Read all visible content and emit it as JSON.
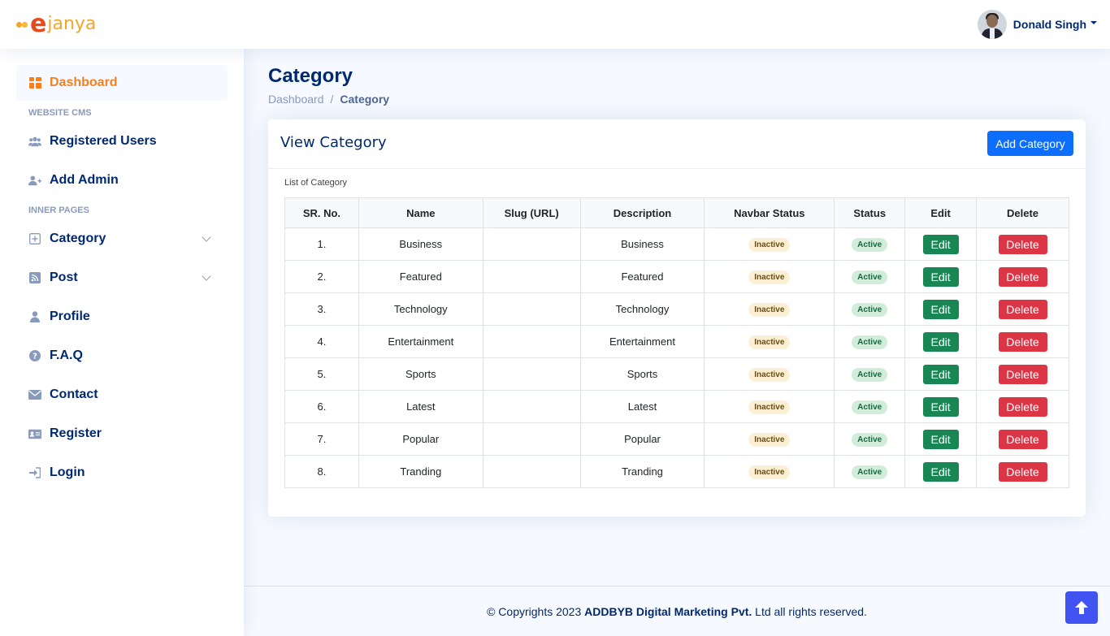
{
  "header": {
    "logo_e": "e",
    "logo_rest": "janya",
    "user_name": "Donald Singh"
  },
  "sidebar": {
    "items": [
      {
        "label": "Dashboard",
        "icon": "grid-icon"
      },
      {
        "label": "Registered Users",
        "icon": "people-icon"
      },
      {
        "label": "Add Admin",
        "icon": "person-plus-icon"
      },
      {
        "label": "Category",
        "icon": "plus-square-icon"
      },
      {
        "label": "Post",
        "icon": "rss-icon"
      },
      {
        "label": "Profile",
        "icon": "person-icon"
      },
      {
        "label": "F.A.Q",
        "icon": "question-circle-icon"
      },
      {
        "label": "Contact",
        "icon": "envelope-icon"
      },
      {
        "label": "Register",
        "icon": "card-icon"
      },
      {
        "label": "Login",
        "icon": "login-icon"
      }
    ],
    "headings": [
      "WEBSITE CMS",
      "INNER PAGES"
    ]
  },
  "page": {
    "title": "Category",
    "breadcrumb": [
      "Dashboard",
      "/",
      "Category"
    ]
  },
  "card": {
    "title": "View Category",
    "add_button": "Add Category",
    "caption": "List of Category",
    "columns": [
      "SR. No.",
      "Name",
      "Slug (URL)",
      "Description",
      "Navbar Status",
      "Status",
      "Edit",
      "Delete"
    ],
    "rows": [
      {
        "sr": "1.",
        "name": "Business",
        "slug": "",
        "desc": "Business",
        "navbar": "Inactive",
        "status": "Active",
        "edit": "Edit",
        "delete": "Delete"
      },
      {
        "sr": "2.",
        "name": "Featured",
        "slug": "",
        "desc": "Featured",
        "navbar": "Inactive",
        "status": "Active",
        "edit": "Edit",
        "delete": "Delete"
      },
      {
        "sr": "3.",
        "name": "Technology",
        "slug": "",
        "desc": "Technology",
        "navbar": "Inactive",
        "status": "Active",
        "edit": "Edit",
        "delete": "Delete"
      },
      {
        "sr": "4.",
        "name": "Entertainment",
        "slug": "",
        "desc": "Entertainment",
        "navbar": "Inactive",
        "status": "Active",
        "edit": "Edit",
        "delete": "Delete"
      },
      {
        "sr": "5.",
        "name": "Sports",
        "slug": "",
        "desc": "Sports",
        "navbar": "Inactive",
        "status": "Active",
        "edit": "Edit",
        "delete": "Delete"
      },
      {
        "sr": "6.",
        "name": "Latest",
        "slug": "",
        "desc": "Latest",
        "navbar": "Inactive",
        "status": "Active",
        "edit": "Edit",
        "delete": "Delete"
      },
      {
        "sr": "7.",
        "name": "Popular",
        "slug": "",
        "desc": "Popular",
        "navbar": "Inactive",
        "status": "Active",
        "edit": "Edit",
        "delete": "Delete"
      },
      {
        "sr": "8.",
        "name": "Tranding",
        "slug": "",
        "desc": "Tranding",
        "navbar": "Inactive",
        "status": "Active",
        "edit": "Edit",
        "delete": "Delete"
      }
    ]
  },
  "footer": {
    "prefix": "© Copyrights 2023 ",
    "company": "ADDBYB Digital Marketing Pvt.",
    "suffix": " Ltd all rights reserved."
  },
  "colors": {
    "accent": "#f77f1c",
    "primary": "#0d6efd",
    "success": "#198754",
    "danger": "#dc3545",
    "nav_text": "#012970"
  }
}
